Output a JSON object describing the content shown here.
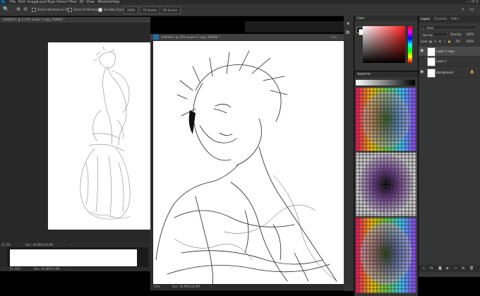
{
  "menubar": {
    "logo": "Ps",
    "items": [
      "File",
      "Edit",
      "Image",
      "Layer",
      "Type",
      "Select",
      "Filter",
      "3D",
      "View",
      "Window",
      "Help"
    ],
    "window_controls": "—  ❐  ✕"
  },
  "options": {
    "resize_windows": "Resize Windows to Fit",
    "zoom_all": "Zoom All Windows",
    "scrubby_zoom": "Scrubby Zoom",
    "zoom_100": "100%",
    "fit_screen": "Fit Screen",
    "fill_screen": "Fill Screen"
  },
  "doc1": {
    "tab": "Untitled-1 @ 11.5% (Layer 1 copy, RGB/8) *",
    "zoom": "11.5%",
    "doc_size": "Doc: 30.9M/118.9M"
  },
  "doc2": {
    "tab": "Untitled-1 @ 50% (Layer 1 copy, RGB/8) *",
    "zoom": "50%",
    "doc_size": "Doc: 30.9M/118.9M"
  },
  "doc3": {
    "zoom": "31.32%",
    "doc_size": "Doc: 24.9M/74.8M"
  },
  "color_panel": {
    "title": "Color"
  },
  "swatches_panel": {
    "title": "Swatches"
  },
  "layers_panel": {
    "tabs": [
      "Layers",
      "Channels",
      "Paths"
    ],
    "filter_label": "Kind",
    "blend_mode": "Normal",
    "opacity_label": "Opacity:",
    "opacity_value": "100%",
    "lock_label": "Lock:",
    "fill_label": "Fill:",
    "fill_value": "100%",
    "layers": [
      {
        "name": "Layer 1 copy",
        "selected": true
      },
      {
        "name": "Layer 1",
        "selected": false
      },
      {
        "name": "Background",
        "selected": false
      }
    ],
    "bottom_icons": [
      "link-icon",
      "fx-icon",
      "mask-icon",
      "adjustment-icon",
      "folder-icon",
      "new-layer-icon",
      "trash-icon"
    ]
  },
  "colors": {
    "app_bg": "#000000",
    "panel_bg": "#353535",
    "selected_layer": "#4a4a4a",
    "accent_red": "#ff1a1a"
  }
}
